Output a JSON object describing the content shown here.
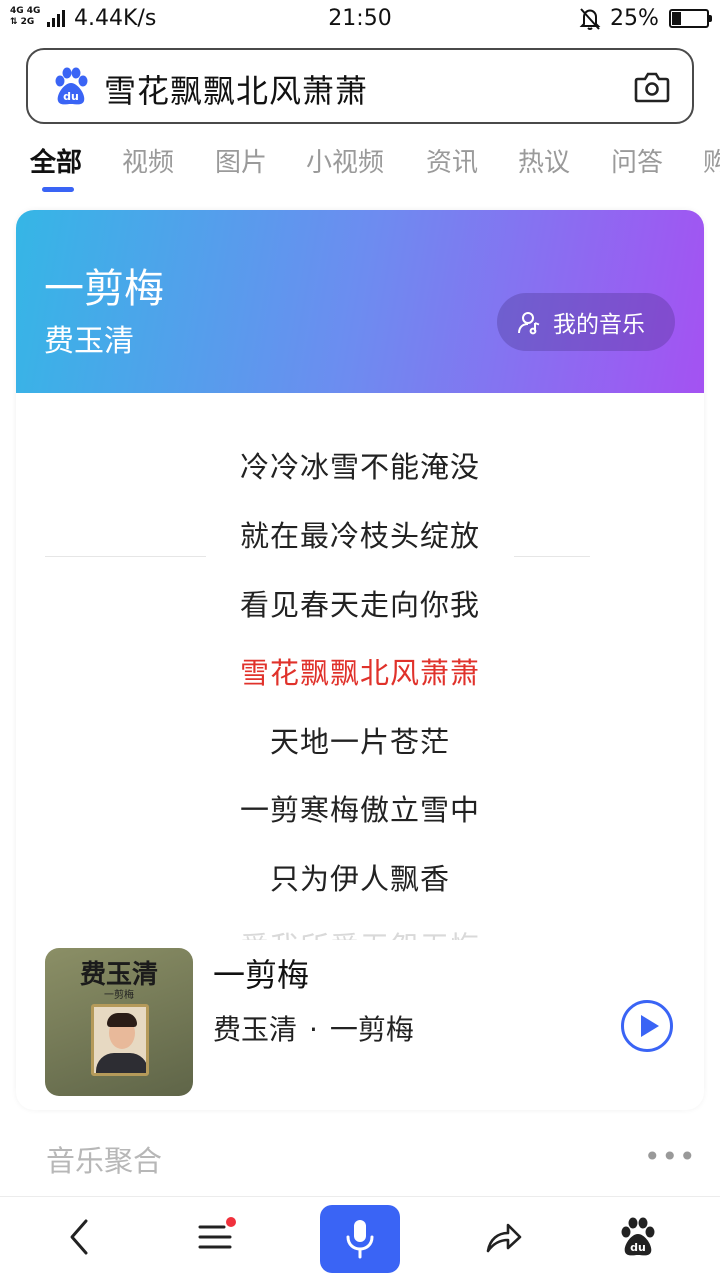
{
  "status_bar": {
    "network": "4G 4G 2G",
    "speed": "4.44K/s",
    "time": "21:50",
    "battery": "25%"
  },
  "search": {
    "query": "雪花飘飘北风萧萧"
  },
  "tabs": [
    {
      "label": "全部",
      "active": true
    },
    {
      "label": "视频",
      "active": false
    },
    {
      "label": "图片",
      "active": false
    },
    {
      "label": "小视频",
      "active": false
    },
    {
      "label": "资讯",
      "active": false
    },
    {
      "label": "热议",
      "active": false
    },
    {
      "label": "问答",
      "active": false
    },
    {
      "label": "购",
      "active": false
    }
  ],
  "music_card": {
    "song_title": "一剪梅",
    "artist": "费玉清",
    "my_music_label": "我的音乐",
    "gradient_colors": [
      "#35b6e6",
      "#a452f2"
    ],
    "lyrics": [
      {
        "text": "冷冷冰雪不能淹没",
        "current": false
      },
      {
        "text": "就在最冷枝头绽放",
        "current": false
      },
      {
        "text": "看见春天走向你我",
        "current": false
      },
      {
        "text": "雪花飘飘北风萧萧",
        "current": true
      },
      {
        "text": "天地一片苍茫",
        "current": false
      },
      {
        "text": "一剪寒梅傲立雪中",
        "current": false
      },
      {
        "text": "只为伊人飘香",
        "current": false
      },
      {
        "text": "爱我所爱无怨无悔",
        "current": false
      }
    ],
    "track": {
      "title": "一剪梅",
      "artist": "费玉清",
      "separator": "·",
      "album": "一剪梅",
      "cover_title": "费玉清",
      "cover_subtitle": "一剪梅"
    }
  },
  "section": {
    "title": "音乐聚合",
    "more": "•••"
  },
  "bottom_nav": [
    {
      "name": "back-icon"
    },
    {
      "name": "menu-icon",
      "badge": true
    },
    {
      "name": "voice-icon"
    },
    {
      "name": "share-icon"
    },
    {
      "name": "baidu-icon"
    }
  ],
  "colors": {
    "accent": "#3a64f5",
    "current_lyric": "#e0322b"
  }
}
